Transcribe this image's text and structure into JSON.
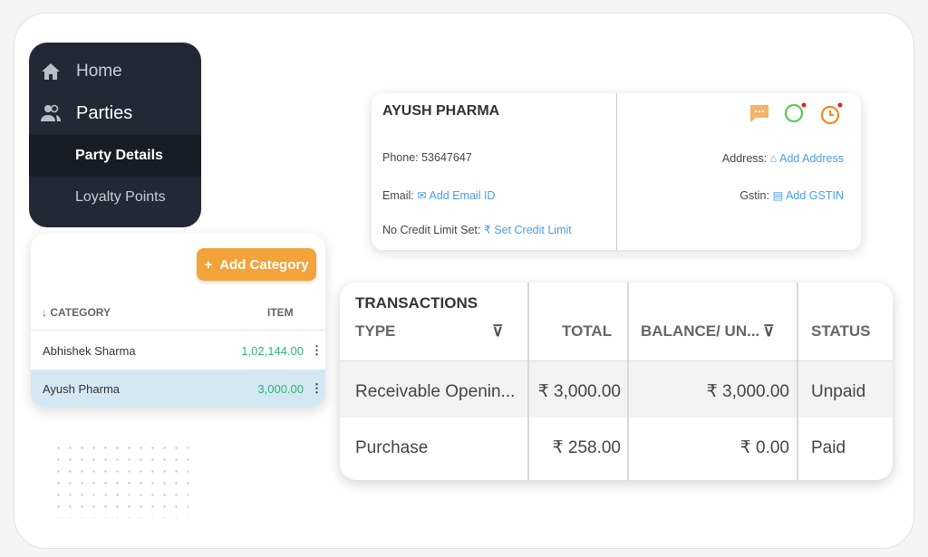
{
  "sidebar": {
    "items": [
      {
        "label": "Home",
        "icon": "home-icon"
      },
      {
        "label": "Parties",
        "icon": "users-icon"
      },
      {
        "label": "Party Details",
        "active": true
      },
      {
        "label": "Loyalty Points"
      }
    ]
  },
  "categories": {
    "add_button": "Add Category",
    "headers": {
      "category": "CATEGORY",
      "item": "ITEM"
    },
    "rows": [
      {
        "name": "Abhishek Sharma",
        "amount": "1,02,144.00"
      },
      {
        "name": "Ayush Pharma",
        "amount": "3,000.00",
        "selected": true
      }
    ]
  },
  "party": {
    "name": "AYUSH PHARMA",
    "phone_label": "Phone:",
    "phone": "53647647",
    "email_label": "Email:",
    "email_link": "Add Email ID",
    "credit_label": "No Credit Limit Set:",
    "credit_link": "Set Credit Limit",
    "address_label": "Address:",
    "address_link": "Add Address",
    "gstin_label": "Gstin:",
    "gstin_link": "Add GSTIN"
  },
  "transactions": {
    "title": "TRANSACTIONS",
    "headers": {
      "type": "TYPE",
      "total": "TOTAL",
      "balance": "BALANCE/ UN...",
      "status": "STATUS"
    },
    "rows": [
      {
        "type": "Receivable Openin...",
        "total": "₹ 3,000.00",
        "balance": "₹ 3,000.00",
        "status": "Unpaid"
      },
      {
        "type": "Purchase",
        "total": "₹ 258.00",
        "balance": "₹ 0.00",
        "status": "Paid"
      }
    ]
  },
  "colors": {
    "sidebar": "#222834",
    "accent": "#f2a33a",
    "link": "#4a9de8",
    "amount": "#2bb673",
    "selected_row": "#d4e8f3"
  }
}
